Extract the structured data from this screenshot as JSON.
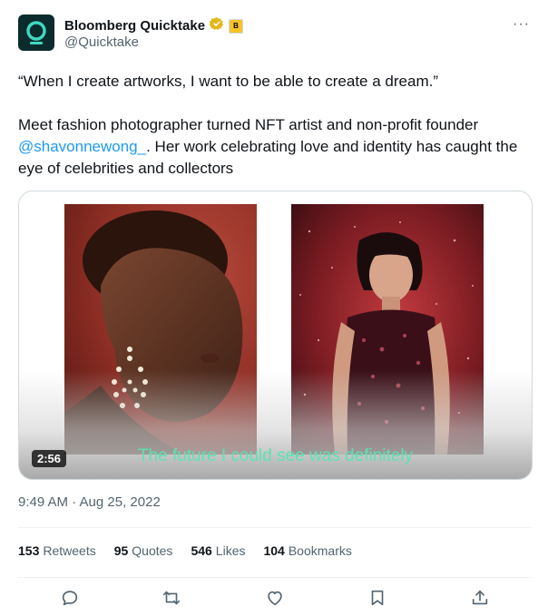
{
  "author": {
    "display_name": "Bloomberg Quicktake",
    "handle": "@Quicktake",
    "affiliate_badge_letter": "B",
    "avatar_color": "#0c2b2d",
    "avatar_accent": "#3fd8c0"
  },
  "tweet": {
    "quote": "“When I create artworks, I want to be able to create a dream.”",
    "body_before": "Meet fashion photographer turned NFT artist and non-profit founder ",
    "mention": "@shavonnewong_",
    "body_after": ". Her work celebrating love and identity has caught the eye of celebrities and collectors"
  },
  "media": {
    "duration": "2:56",
    "subtitle": "The future I could see was definitely"
  },
  "timestamp": "9:49 AM · Aug 25, 2022",
  "stats": {
    "retweets_count": "153",
    "retweets_label": "Retweets",
    "quotes_count": "95",
    "quotes_label": "Quotes",
    "likes_count": "546",
    "likes_label": "Likes",
    "bookmarks_count": "104",
    "bookmarks_label": "Bookmarks"
  },
  "more_label": "···",
  "icons": [
    "reply-icon",
    "retweet-icon",
    "like-icon",
    "bookmark-icon",
    "share-icon",
    "verified-badge-icon"
  ],
  "colors": {
    "link": "#1d9bf0",
    "secondary_text": "#536471",
    "verified": "#e2b719",
    "subtitle": "#5be3b3"
  }
}
